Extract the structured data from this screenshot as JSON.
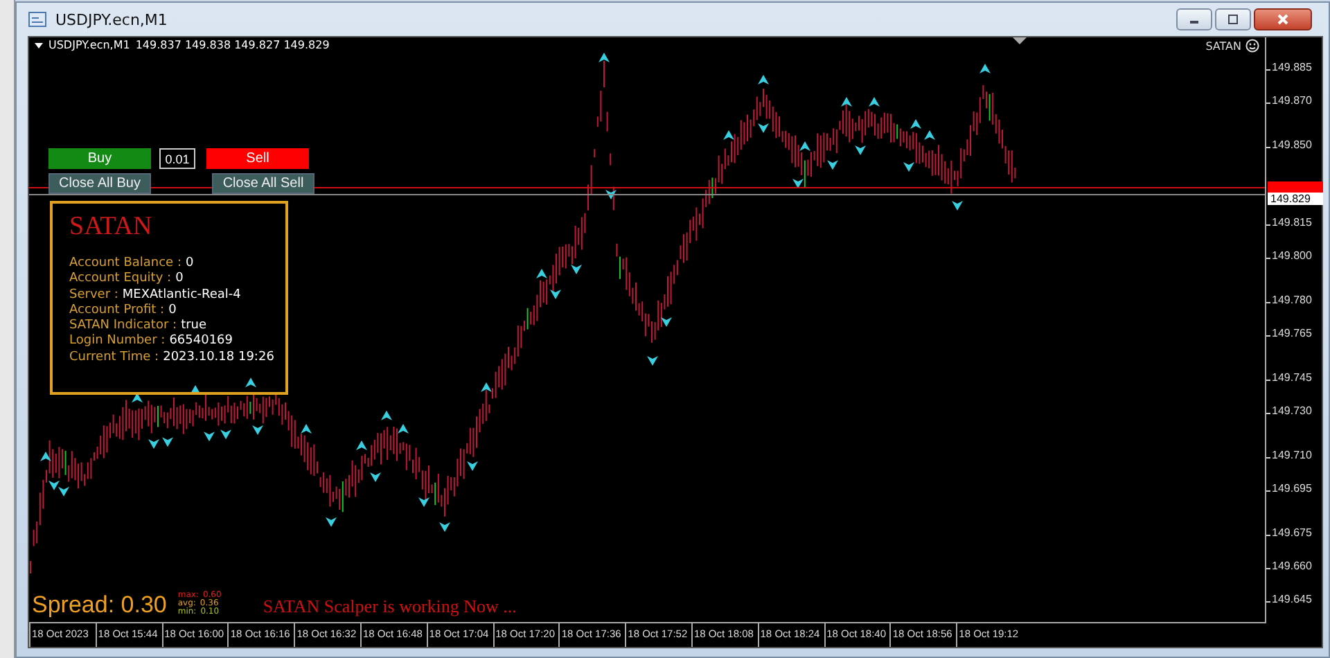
{
  "window": {
    "title": "USDJPY.ecn,M1"
  },
  "chart": {
    "symbol": "USDJPY.ecn,M1",
    "ohlc": "149.837 149.838 149.827 149.829",
    "indicator": "SATAN",
    "price_ticks": [
      "149.885",
      "149.870",
      "149.850",
      "149.815",
      "149.800",
      "149.780",
      "149.765",
      "149.745",
      "149.730",
      "149.710",
      "149.695",
      "149.675",
      "149.660",
      "149.645"
    ],
    "current_price": "149.829",
    "time_labels": [
      "18 Oct 2023",
      "18 Oct 15:44",
      "18 Oct 16:00",
      "18 Oct 16:16",
      "18 Oct 16:32",
      "18 Oct 16:48",
      "18 Oct 17:04",
      "18 Oct 17:20",
      "18 Oct 17:36",
      "18 Oct 17:52",
      "18 Oct 18:08",
      "18 Oct 18:24",
      "18 Oct 18:40",
      "18 Oct 18:56",
      "18 Oct 19:12"
    ]
  },
  "trade_panel": {
    "buy": "Buy",
    "lot": "0.01",
    "sell": "Sell",
    "close_buy": "Close All Buy",
    "close_sell": "Close All Sell"
  },
  "info_box": {
    "title": "SATAN",
    "rows": [
      {
        "label": "Account Balance  :",
        "value": "0"
      },
      {
        "label": "Account Equity :",
        "value": "0"
      },
      {
        "label": "Server :",
        "value": "MEXAtlantic-Real-4"
      },
      {
        "label": "Account Profit :",
        "value": "0"
      },
      {
        "label": "SATAN  Indicator :",
        "value": "true"
      },
      {
        "label": "Login Number  :",
        "value": "66540169"
      },
      {
        "label": "Current Time :",
        "value": "2023.10.18 19:26"
      }
    ]
  },
  "spread": {
    "text": "Spread: 0.30",
    "stats": [
      {
        "label": "max:",
        "value": "0.60",
        "color": "#e02020"
      },
      {
        "label": "avg:",
        "value": "0.36",
        "color": "#e0a020"
      },
      {
        "label": "min:",
        "value": "0.10",
        "color": "#b0c020"
      }
    ]
  },
  "status_message": "SATAN Scalper is working Now ..."
}
